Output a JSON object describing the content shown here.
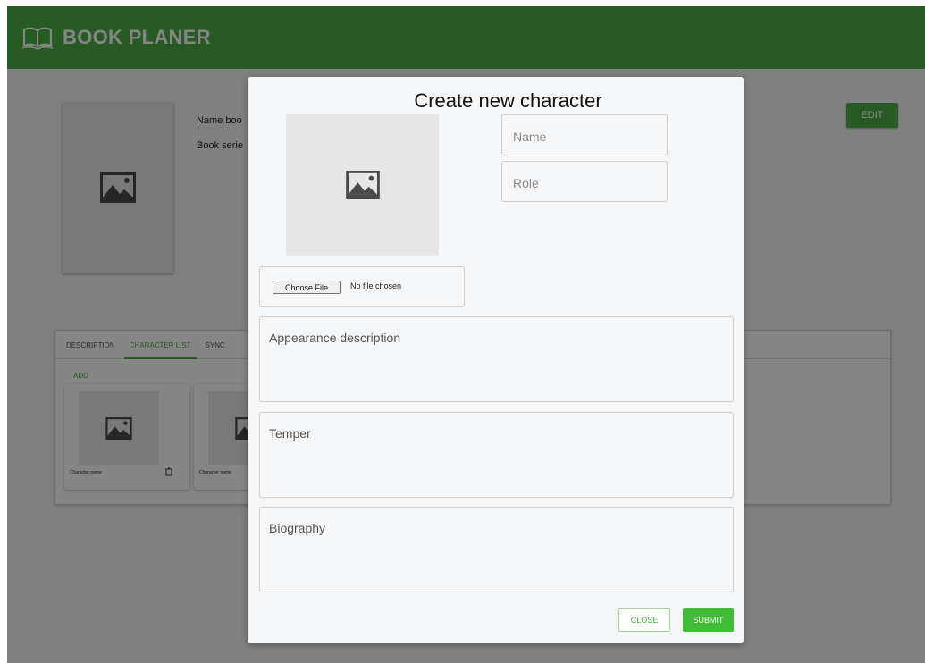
{
  "header": {
    "title": "BOOK PLANER",
    "logo_icon": "open-book-icon"
  },
  "book": {
    "name_label": "Name boo",
    "series_label": "Book serie",
    "cover_icon": "image-placeholder-icon",
    "edit_label": "EDIT"
  },
  "tabs": [
    {
      "label": "DESCRIPTION"
    },
    {
      "label": "CHARACTER LIST"
    },
    {
      "label": "SYNC"
    }
  ],
  "character_list": {
    "add_label": "ADD",
    "cards": [
      {
        "name": "Character name"
      },
      {
        "name": "Character name"
      }
    ]
  },
  "modal": {
    "title": "Create new character",
    "preview_icon": "image-placeholder-icon",
    "name_placeholder": "Name",
    "role_placeholder": "Role",
    "choose_file_label": "Choose File",
    "no_file_label": "No file chosen",
    "appearance_placeholder": "Appearance description",
    "temper_placeholder": "Temper",
    "biography_placeholder": "Biography",
    "close_label": "CLOSE",
    "submit_label": "SUBMIT"
  },
  "colors": {
    "brand_green": "#4caf43",
    "submit_green": "#3fbd34"
  }
}
